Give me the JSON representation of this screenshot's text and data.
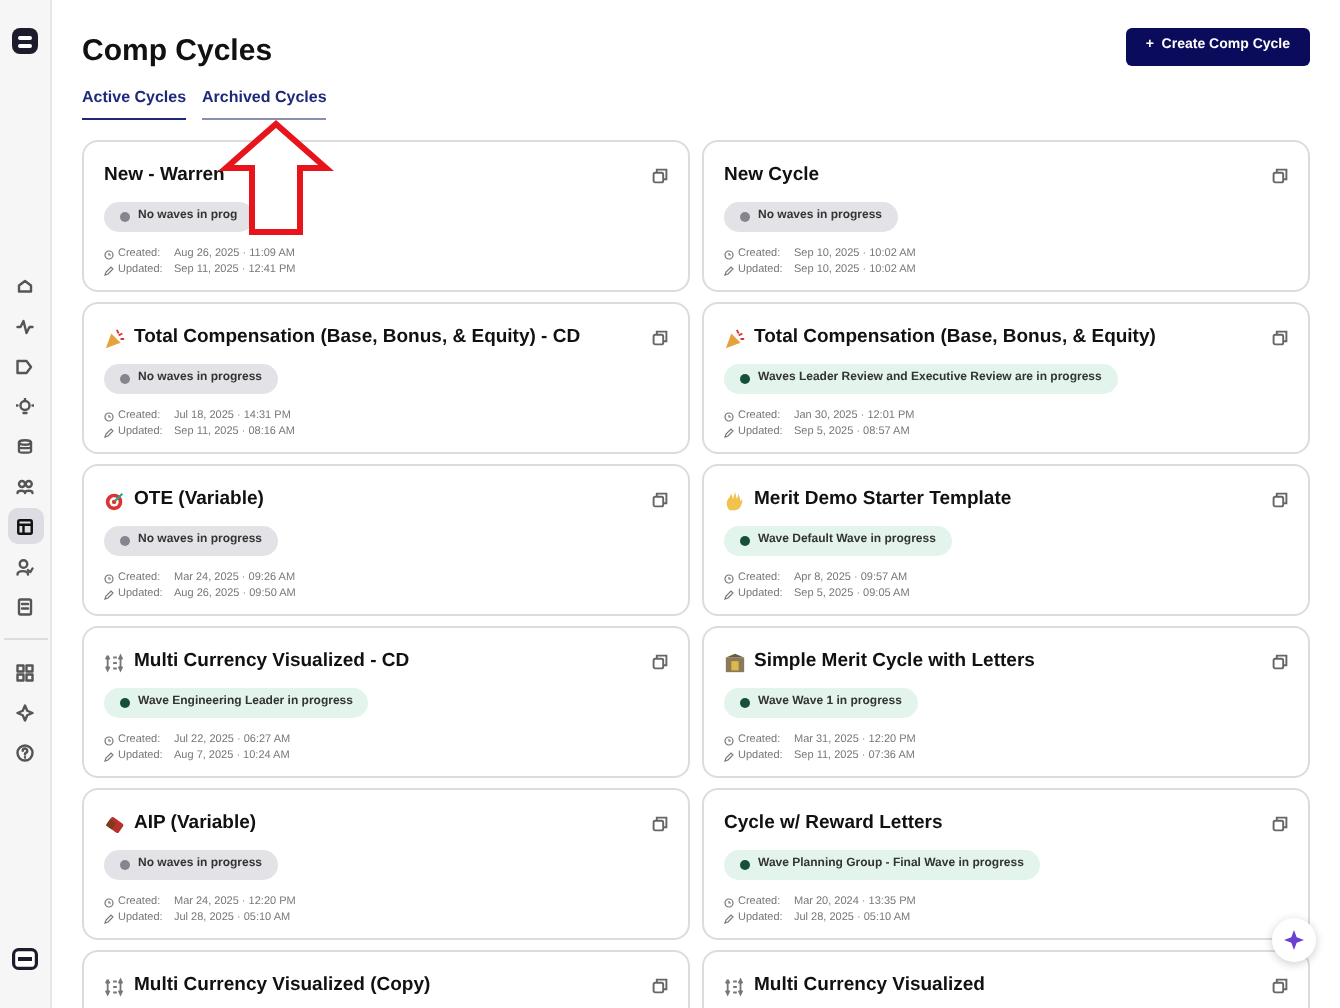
{
  "sidebar": {
    "items": [
      {
        "kind": "home",
        "selected": false
      },
      {
        "kind": "activity",
        "selected": false
      },
      {
        "kind": "tag",
        "selected": false
      },
      {
        "kind": "bulb",
        "selected": false
      },
      {
        "kind": "database",
        "selected": false
      },
      {
        "kind": "users",
        "selected": false
      },
      {
        "kind": "layout",
        "selected": true
      },
      {
        "kind": "usercheck",
        "selected": false
      },
      {
        "kind": "document",
        "selected": false
      }
    ],
    "tools": [
      {
        "kind": "grid",
        "selected": false
      },
      {
        "kind": "sparkle",
        "selected": false
      },
      {
        "kind": "help",
        "selected": false
      }
    ]
  },
  "header": {
    "title": "Comp Cycles",
    "button": "+  Create Comp Cycle"
  },
  "tabs": [
    {
      "label": "Active Cycles",
      "selected": true
    },
    {
      "label": "Archived Cycles",
      "selected": false
    }
  ],
  "cycles": [
    {
      "kind": "plain",
      "title": "New - Warren",
      "status": "No waves in prog",
      "in_progress": false,
      "created_label": "Created:",
      "created": "Aug 26, 2025 · 11:09 AM",
      "updated_label": "Updated:",
      "updated": "Sep 11, 2025 · 12:41 PM"
    },
    {
      "kind": "plain",
      "title": "New Cycle",
      "status": "No waves in progress",
      "in_progress": false,
      "created_label": "Created:",
      "created": "Sep 10, 2025 · 10:02 AM",
      "updated_label": "Updated:",
      "updated": "Sep 10, 2025 · 10:02 AM"
    },
    {
      "kind": "party",
      "title": "Total Compensation (Base, Bonus, & Equity) - CD",
      "status": "No waves in progress",
      "in_progress": false,
      "created_label": "Created:",
      "created": "Jul 18, 2025 · 14:31 PM",
      "updated_label": "Updated:",
      "updated": "Sep 11, 2025 · 08:16 AM"
    },
    {
      "kind": "party",
      "title": "Total Compensation (Base, Bonus, & Equity)",
      "status": "Waves Leader Review and Executive Review are in progress",
      "in_progress": true,
      "created_label": "Created:",
      "created": "Jan 30, 2025 · 12:01 PM",
      "updated_label": "Updated:",
      "updated": "Sep 5, 2025 · 08:57 AM"
    },
    {
      "kind": "target",
      "title": "OTE (Variable)",
      "status": "No waves in progress",
      "in_progress": false,
      "created_label": "Created:",
      "created": "Mar 24, 2025 · 09:26 AM",
      "updated_label": "Updated:",
      "updated": "Aug 26, 2025 · 09:50 AM"
    },
    {
      "kind": "wave",
      "title": "Merit Demo Starter Template",
      "status": "Wave Default Wave in progress",
      "in_progress": true,
      "created_label": "Created:",
      "created": "Apr 8, 2025 · 09:57 AM",
      "updated_label": "Updated:",
      "updated": "Sep 5, 2025 · 09:05 AM"
    },
    {
      "kind": "exchange",
      "title": "Multi Currency Visualized - CD",
      "status": "Wave Engineering Leader in progress",
      "in_progress": true,
      "created_label": "Created:",
      "created": "Jul 22, 2025 · 06:27 AM",
      "updated_label": "Updated:",
      "updated": "Aug 7, 2025 · 10:24 AM"
    },
    {
      "kind": "bank",
      "title": "Simple Merit Cycle with Letters",
      "status": "Wave Wave 1 in progress",
      "in_progress": true,
      "created_label": "Created:",
      "created": "Mar 31, 2025 · 12:20 PM",
      "updated_label": "Updated:",
      "updated": "Sep 11, 2025 · 07:36 AM"
    },
    {
      "kind": "candy",
      "title": "AIP (Variable)",
      "status": "No waves in progress",
      "in_progress": false,
      "created_label": "Created:",
      "created": "Mar 24, 2025 · 12:20 PM",
      "updated_label": "Updated:",
      "updated": "Jul 28, 2025 · 05:10 AM"
    },
    {
      "kind": "plain",
      "title": "Cycle w/ Reward Letters",
      "status": "Wave Planning Group - Final Wave in progress",
      "in_progress": true,
      "created_label": "Created:",
      "created": "Mar 20, 2024 · 13:35 PM",
      "updated_label": "Updated:",
      "updated": "Jul 28, 2025 · 05:10 AM"
    },
    {
      "kind": "exchange",
      "title": "Multi Currency Visualized (Copy)"
    },
    {
      "kind": "exchange",
      "title": "Multi Currency Visualized"
    }
  ]
}
